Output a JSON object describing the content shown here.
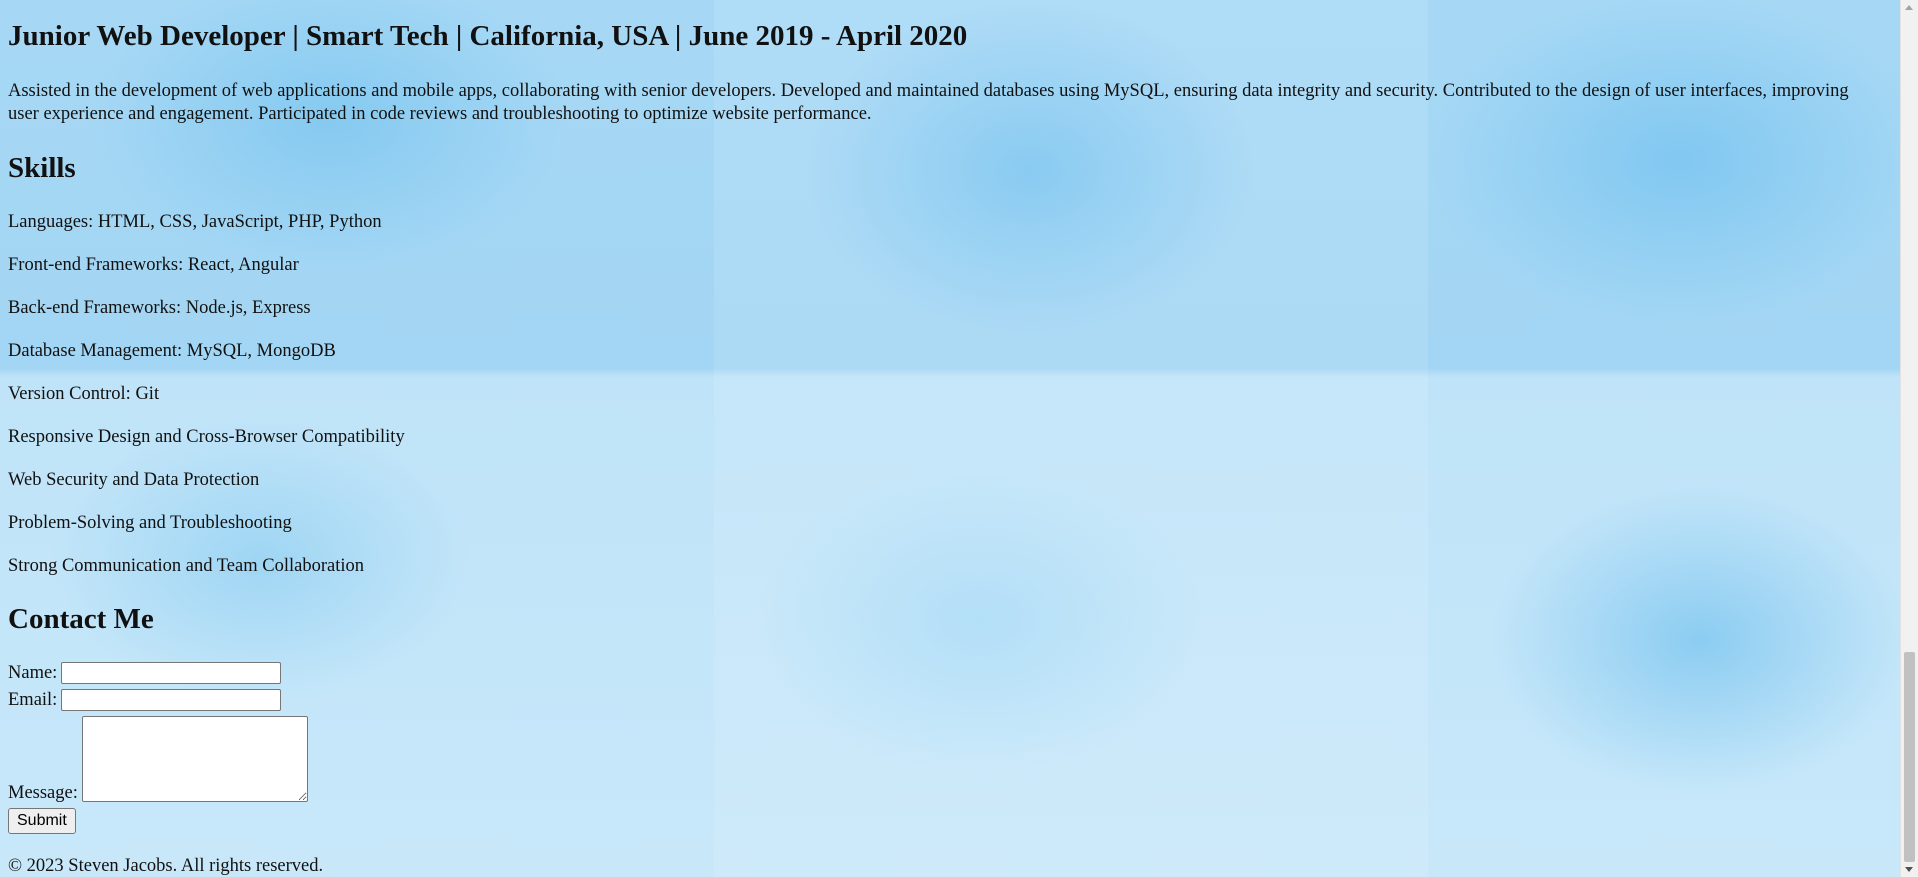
{
  "experience": {
    "job_title": "Junior Web Developer | Smart Tech | California, USA | June 2019 - April 2020",
    "description": "Assisted in the development of web applications and mobile apps, collaborating with senior developers. Developed and maintained databases using MySQL, ensuring data integrity and security. Contributed to the design of user interfaces, improving user experience and engagement. Participated in code reviews and troubleshooting to optimize website performance."
  },
  "skills": {
    "title": "Skills",
    "items": [
      "Languages: HTML, CSS, JavaScript, PHP, Python",
      "Front-end Frameworks: React, Angular",
      "Back-end Frameworks: Node.js, Express",
      "Database Management: MySQL, MongoDB",
      "Version Control: Git",
      "Responsive Design and Cross-Browser Compatibility",
      "Web Security and Data Protection",
      "Problem-Solving and Troubleshooting",
      "Strong Communication and Team Collaboration"
    ]
  },
  "contact": {
    "title": "Contact Me",
    "name_label": "Name:",
    "name_value": "",
    "email_label": "Email:",
    "email_value": "",
    "message_label": "Message:",
    "message_value": "",
    "submit_label": "Submit"
  },
  "footer": {
    "text": "© 2023 Steven Jacobs. All rights reserved."
  }
}
